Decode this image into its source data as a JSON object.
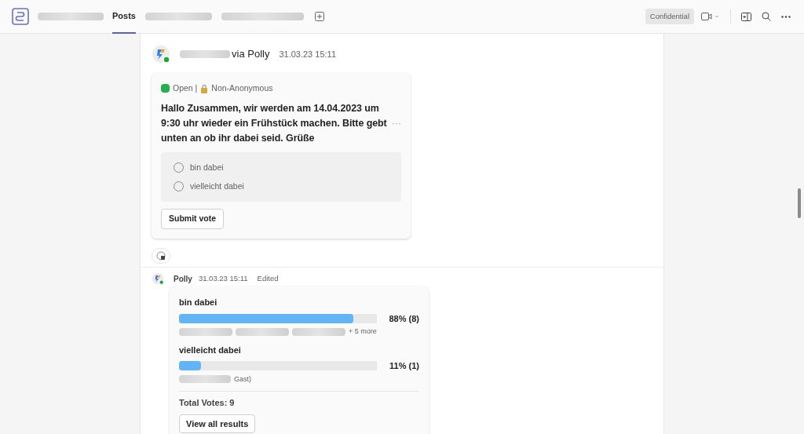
{
  "header": {
    "tabs": [
      {
        "label": "Posts",
        "selected": true
      }
    ],
    "sensitivity": "Confidential"
  },
  "messages": [
    {
      "kind": "poll",
      "via": "via Polly",
      "time": "31.03.23 15:11",
      "status": "Open | ",
      "anonymity": "Non-Anonymous",
      "question": "Hallo Zusammen, wir werden am 14.04.2023 um 9:30 uhr wieder ein Frühstück machen. Bitte gebt unten an ob ihr dabei seid. Grüße",
      "menu": "···",
      "options": [
        {
          "label": "bin dabei",
          "selected": false
        },
        {
          "label": "vielleicht dabei",
          "selected": false
        }
      ],
      "button": "Submit vote"
    },
    {
      "kind": "results",
      "author": "Polly",
      "time": "31.03.23 15:11",
      "edited": "Edited",
      "results": [
        {
          "label": "bin dabei",
          "level": 0.88,
          "reading": "88% (8)",
          "voters_suffix": "+ 5 more"
        },
        {
          "label": "vielleicht dabei",
          "level": 0.11,
          "reading": "11% (1)",
          "voters_suffix": "Gast)"
        }
      ],
      "total": "Total Votes: 9",
      "button": "View all results"
    }
  ]
}
